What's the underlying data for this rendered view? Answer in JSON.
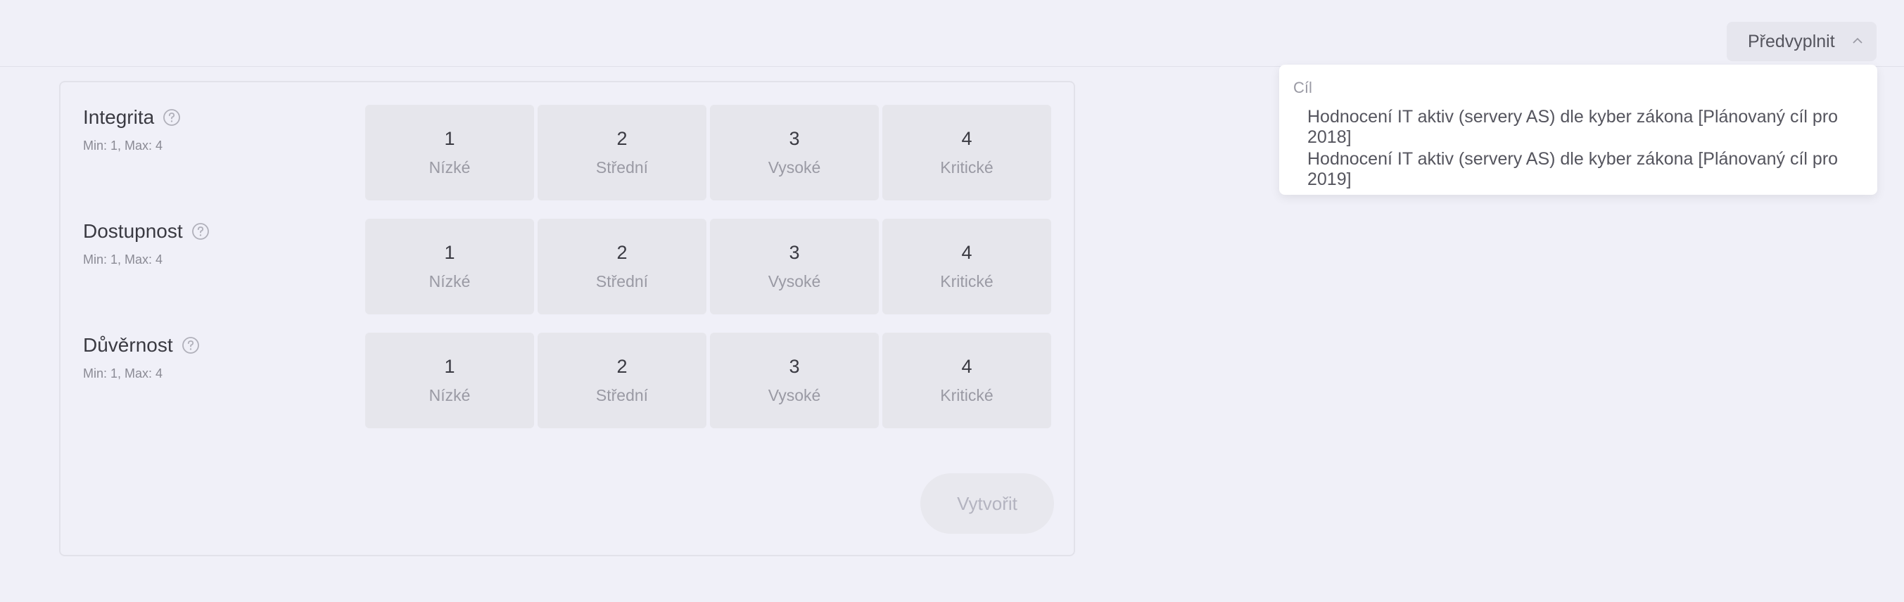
{
  "header": {
    "prefill_label": "Předvyplnit",
    "chevron_icon": "chevron-up-icon"
  },
  "form": {
    "rows": [
      {
        "title": "Integrita",
        "subtitle": "Min: 1, Max: 4",
        "options": [
          {
            "num": "1",
            "label": "Nízké"
          },
          {
            "num": "2",
            "label": "Střední"
          },
          {
            "num": "3",
            "label": "Vysoké"
          },
          {
            "num": "4",
            "label": "Kritické"
          }
        ]
      },
      {
        "title": "Dostupnost",
        "subtitle": "Min: 1, Max: 4",
        "options": [
          {
            "num": "1",
            "label": "Nízké"
          },
          {
            "num": "2",
            "label": "Střední"
          },
          {
            "num": "3",
            "label": "Vysoké"
          },
          {
            "num": "4",
            "label": "Kritické"
          }
        ]
      },
      {
        "title": "Důvěrnost",
        "subtitle": "Min: 1, Max: 4",
        "options": [
          {
            "num": "1",
            "label": "Nízké"
          },
          {
            "num": "2",
            "label": "Střední"
          },
          {
            "num": "3",
            "label": "Vysoké"
          },
          {
            "num": "4",
            "label": "Kritické"
          }
        ]
      }
    ],
    "create_label": "Vytvořit"
  },
  "dropdown": {
    "group_label": "Cíl",
    "items": [
      "Hodnocení IT aktiv (servery AS) dle kyber zákona [Plánovaný cíl pro 2018]",
      "Hodnocení IT aktiv (servery AS) dle kyber zákona [Plánovaný cíl pro 2019]"
    ]
  }
}
